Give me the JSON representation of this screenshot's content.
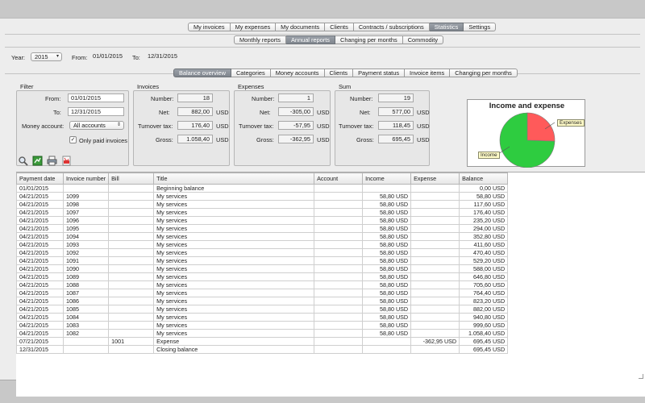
{
  "main_tabs": [
    "My invoices",
    "My expenses",
    "My documents",
    "Clients",
    "Contracts / subscriptions",
    "Statistics",
    "Settings"
  ],
  "main_tab_active": "Statistics",
  "sub_tabs": [
    "Monthly reports",
    "Annual reports",
    "Changing per months",
    "Commodity"
  ],
  "sub_tab_active": "Annual reports",
  "period": {
    "year_label": "Year:",
    "year_value": "2015",
    "from_label": "From:",
    "from_value": "01/01/2015",
    "to_label": "To:",
    "to_value": "12/31/2015"
  },
  "view_tabs": [
    "Balance overview",
    "Categories",
    "Money accounts",
    "Clients",
    "Payment status",
    "Invoice items",
    "Changing per months"
  ],
  "view_tab_active": "Balance overview",
  "filter": {
    "title": "Filter",
    "from_label": "From:",
    "from_value": "01/01/2015",
    "to_label": "To:",
    "to_value": "12/31/2015",
    "account_label": "Money account:",
    "account_value": "All accounts",
    "paid_label": "Only paid invoices",
    "paid_checked": true
  },
  "invoices": {
    "title": "Invoices",
    "number_label": "Number:",
    "number": "18",
    "net_label": "Net:",
    "net": "882,00",
    "net_cur": "USD",
    "tax_label": "Turnover tax:",
    "tax": "176,40",
    "tax_cur": "USD",
    "gross_label": "Gross:",
    "gross": "1.058,40",
    "gross_cur": "USD"
  },
  "expenses": {
    "title": "Expenses",
    "number_label": "Number:",
    "number": "1",
    "net_label": "Net:",
    "net": "-305,00",
    "net_cur": "USD",
    "tax_label": "Turnover tax:",
    "tax": "-57,95",
    "tax_cur": "USD",
    "gross_label": "Gross:",
    "gross": "-362,95",
    "gross_cur": "USD"
  },
  "sum": {
    "title": "Sum",
    "number_label": "Number:",
    "number": "19",
    "net_label": "Net:",
    "net": "577,00",
    "net_cur": "USD",
    "tax_label": "Turnover tax:",
    "tax": "118,45",
    "tax_cur": "USD",
    "gross_label": "Gross:",
    "gross": "695,45",
    "gross_cur": "USD"
  },
  "chart_data": {
    "type": "pie",
    "title": "Income and expense",
    "categories": [
      "Income",
      "Expenses"
    ],
    "values": [
      1058.4,
      362.95
    ],
    "colors": [
      "#2ecc40",
      "#ff5a5a"
    ],
    "legend": "labels on slices"
  },
  "table": {
    "columns": [
      "Payment date",
      "Invoice number",
      "Bill",
      "Title",
      "Account",
      "Income",
      "Expense",
      "Balance"
    ],
    "rows": [
      [
        "01/01/2015",
        "",
        "",
        "Beginning balance",
        "",
        "",
        "",
        "0,00 USD"
      ],
      [
        "04/21/2015",
        "1099",
        "",
        "My services",
        "",
        "58,80 USD",
        "",
        "58,80 USD"
      ],
      [
        "04/21/2015",
        "1098",
        "",
        "My services",
        "",
        "58,80 USD",
        "",
        "117,60 USD"
      ],
      [
        "04/21/2015",
        "1097",
        "",
        "My services",
        "",
        "58,80 USD",
        "",
        "176,40 USD"
      ],
      [
        "04/21/2015",
        "1096",
        "",
        "My services",
        "",
        "58,80 USD",
        "",
        "235,20 USD"
      ],
      [
        "04/21/2015",
        "1095",
        "",
        "My services",
        "",
        "58,80 USD",
        "",
        "294,00 USD"
      ],
      [
        "04/21/2015",
        "1094",
        "",
        "My services",
        "",
        "58,80 USD",
        "",
        "352,80 USD"
      ],
      [
        "04/21/2015",
        "1093",
        "",
        "My services",
        "",
        "58,80 USD",
        "",
        "411,60 USD"
      ],
      [
        "04/21/2015",
        "1092",
        "",
        "My services",
        "",
        "58,80 USD",
        "",
        "470,40 USD"
      ],
      [
        "04/21/2015",
        "1091",
        "",
        "My services",
        "",
        "58,80 USD",
        "",
        "529,20 USD"
      ],
      [
        "04/21/2015",
        "1090",
        "",
        "My services",
        "",
        "58,80 USD",
        "",
        "588,00 USD"
      ],
      [
        "04/21/2015",
        "1089",
        "",
        "My services",
        "",
        "58,80 USD",
        "",
        "646,80 USD"
      ],
      [
        "04/21/2015",
        "1088",
        "",
        "My services",
        "",
        "58,80 USD",
        "",
        "705,60 USD"
      ],
      [
        "04/21/2015",
        "1087",
        "",
        "My services",
        "",
        "58,80 USD",
        "",
        "764,40 USD"
      ],
      [
        "04/21/2015",
        "1086",
        "",
        "My services",
        "",
        "58,80 USD",
        "",
        "823,20 USD"
      ],
      [
        "04/21/2015",
        "1085",
        "",
        "My services",
        "",
        "58,80 USD",
        "",
        "882,00 USD"
      ],
      [
        "04/21/2015",
        "1084",
        "",
        "My services",
        "",
        "58,80 USD",
        "",
        "940,80 USD"
      ],
      [
        "04/21/2015",
        "1083",
        "",
        "My services",
        "",
        "58,80 USD",
        "",
        "999,60 USD"
      ],
      [
        "04/21/2015",
        "1082",
        "",
        "My services",
        "",
        "58,80 USD",
        "",
        "1.058,40 USD"
      ],
      [
        "07/21/2015",
        "",
        "1001",
        "Expense",
        "",
        "",
        "-362,95 USD",
        "695,45 USD"
      ],
      [
        "12/31/2015",
        "",
        "",
        "Closing balance",
        "",
        "",
        "",
        "695,45 USD"
      ]
    ]
  },
  "toolbar_icons": [
    "search-icon",
    "export-spreadsheet-icon",
    "print-icon",
    "pdf-icon"
  ]
}
